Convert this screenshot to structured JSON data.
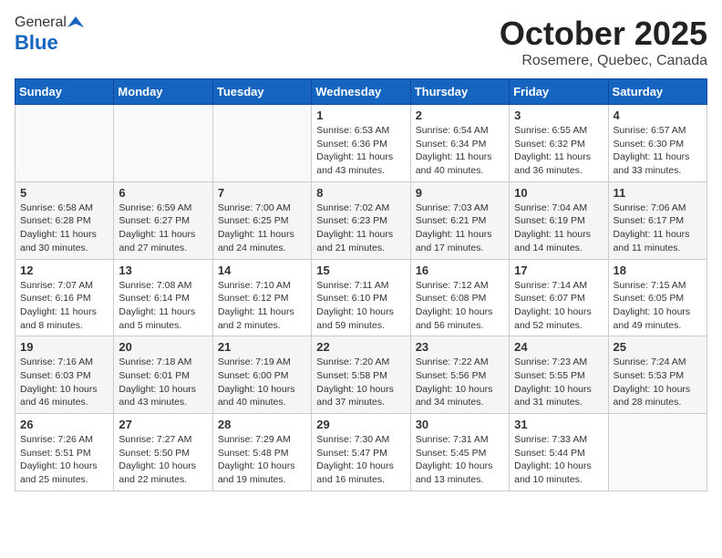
{
  "header": {
    "logo_general": "General",
    "logo_blue": "Blue",
    "month_title": "October 2025",
    "location": "Rosemere, Quebec, Canada"
  },
  "weekdays": [
    "Sunday",
    "Monday",
    "Tuesday",
    "Wednesday",
    "Thursday",
    "Friday",
    "Saturday"
  ],
  "weeks": [
    [
      {
        "day": "",
        "info": ""
      },
      {
        "day": "",
        "info": ""
      },
      {
        "day": "",
        "info": ""
      },
      {
        "day": "1",
        "info": "Sunrise: 6:53 AM\nSunset: 6:36 PM\nDaylight: 11 hours\nand 43 minutes."
      },
      {
        "day": "2",
        "info": "Sunrise: 6:54 AM\nSunset: 6:34 PM\nDaylight: 11 hours\nand 40 minutes."
      },
      {
        "day": "3",
        "info": "Sunrise: 6:55 AM\nSunset: 6:32 PM\nDaylight: 11 hours\nand 36 minutes."
      },
      {
        "day": "4",
        "info": "Sunrise: 6:57 AM\nSunset: 6:30 PM\nDaylight: 11 hours\nand 33 minutes."
      }
    ],
    [
      {
        "day": "5",
        "info": "Sunrise: 6:58 AM\nSunset: 6:28 PM\nDaylight: 11 hours\nand 30 minutes."
      },
      {
        "day": "6",
        "info": "Sunrise: 6:59 AM\nSunset: 6:27 PM\nDaylight: 11 hours\nand 27 minutes."
      },
      {
        "day": "7",
        "info": "Sunrise: 7:00 AM\nSunset: 6:25 PM\nDaylight: 11 hours\nand 24 minutes."
      },
      {
        "day": "8",
        "info": "Sunrise: 7:02 AM\nSunset: 6:23 PM\nDaylight: 11 hours\nand 21 minutes."
      },
      {
        "day": "9",
        "info": "Sunrise: 7:03 AM\nSunset: 6:21 PM\nDaylight: 11 hours\nand 17 minutes."
      },
      {
        "day": "10",
        "info": "Sunrise: 7:04 AM\nSunset: 6:19 PM\nDaylight: 11 hours\nand 14 minutes."
      },
      {
        "day": "11",
        "info": "Sunrise: 7:06 AM\nSunset: 6:17 PM\nDaylight: 11 hours\nand 11 minutes."
      }
    ],
    [
      {
        "day": "12",
        "info": "Sunrise: 7:07 AM\nSunset: 6:16 PM\nDaylight: 11 hours\nand 8 minutes."
      },
      {
        "day": "13",
        "info": "Sunrise: 7:08 AM\nSunset: 6:14 PM\nDaylight: 11 hours\nand 5 minutes."
      },
      {
        "day": "14",
        "info": "Sunrise: 7:10 AM\nSunset: 6:12 PM\nDaylight: 11 hours\nand 2 minutes."
      },
      {
        "day": "15",
        "info": "Sunrise: 7:11 AM\nSunset: 6:10 PM\nDaylight: 10 hours\nand 59 minutes."
      },
      {
        "day": "16",
        "info": "Sunrise: 7:12 AM\nSunset: 6:08 PM\nDaylight: 10 hours\nand 56 minutes."
      },
      {
        "day": "17",
        "info": "Sunrise: 7:14 AM\nSunset: 6:07 PM\nDaylight: 10 hours\nand 52 minutes."
      },
      {
        "day": "18",
        "info": "Sunrise: 7:15 AM\nSunset: 6:05 PM\nDaylight: 10 hours\nand 49 minutes."
      }
    ],
    [
      {
        "day": "19",
        "info": "Sunrise: 7:16 AM\nSunset: 6:03 PM\nDaylight: 10 hours\nand 46 minutes."
      },
      {
        "day": "20",
        "info": "Sunrise: 7:18 AM\nSunset: 6:01 PM\nDaylight: 10 hours\nand 43 minutes."
      },
      {
        "day": "21",
        "info": "Sunrise: 7:19 AM\nSunset: 6:00 PM\nDaylight: 10 hours\nand 40 minutes."
      },
      {
        "day": "22",
        "info": "Sunrise: 7:20 AM\nSunset: 5:58 PM\nDaylight: 10 hours\nand 37 minutes."
      },
      {
        "day": "23",
        "info": "Sunrise: 7:22 AM\nSunset: 5:56 PM\nDaylight: 10 hours\nand 34 minutes."
      },
      {
        "day": "24",
        "info": "Sunrise: 7:23 AM\nSunset: 5:55 PM\nDaylight: 10 hours\nand 31 minutes."
      },
      {
        "day": "25",
        "info": "Sunrise: 7:24 AM\nSunset: 5:53 PM\nDaylight: 10 hours\nand 28 minutes."
      }
    ],
    [
      {
        "day": "26",
        "info": "Sunrise: 7:26 AM\nSunset: 5:51 PM\nDaylight: 10 hours\nand 25 minutes."
      },
      {
        "day": "27",
        "info": "Sunrise: 7:27 AM\nSunset: 5:50 PM\nDaylight: 10 hours\nand 22 minutes."
      },
      {
        "day": "28",
        "info": "Sunrise: 7:29 AM\nSunset: 5:48 PM\nDaylight: 10 hours\nand 19 minutes."
      },
      {
        "day": "29",
        "info": "Sunrise: 7:30 AM\nSunset: 5:47 PM\nDaylight: 10 hours\nand 16 minutes."
      },
      {
        "day": "30",
        "info": "Sunrise: 7:31 AM\nSunset: 5:45 PM\nDaylight: 10 hours\nand 13 minutes."
      },
      {
        "day": "31",
        "info": "Sunrise: 7:33 AM\nSunset: 5:44 PM\nDaylight: 10 hours\nand 10 minutes."
      },
      {
        "day": "",
        "info": ""
      }
    ]
  ]
}
